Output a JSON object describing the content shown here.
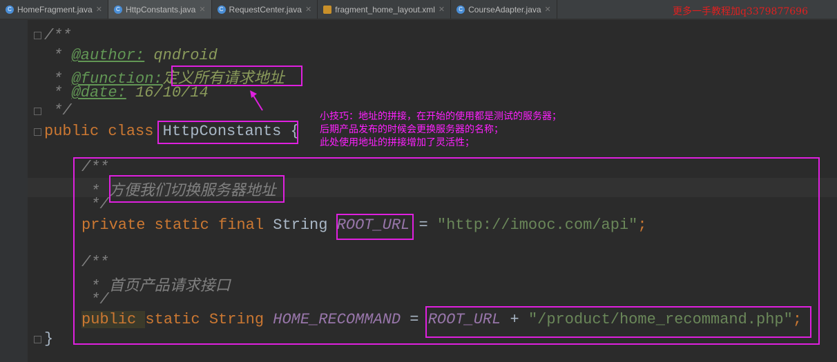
{
  "tabs": [
    {
      "label": "HomeFragment.java",
      "icon": "class-icon"
    },
    {
      "label": "HttpConstants.java",
      "icon": "class-icon",
      "active": true
    },
    {
      "label": "RequestCenter.java",
      "icon": "class-icon"
    },
    {
      "label": "fragment_home_layout.xml",
      "icon": "xml-icon"
    },
    {
      "label": "CourseAdapter.java",
      "icon": "class-icon"
    }
  ],
  "promo": "更多一手教程加q3379877696",
  "code": {
    "l1": "/**",
    "l2a": " * ",
    "l2tag": "@author:",
    "l2v": " qndroid",
    "l3a": " * ",
    "l3tag": "@function:",
    "l3v": "定义所有请求地址",
    "l4a": " * ",
    "l4tag": "@date:",
    "l4v": " 16/10/14",
    "l5": " */",
    "l6kw": "public class ",
    "l6n": "HttpConstants",
    "l6e": " {",
    "l7": "/**",
    "l8": " * 方便我们切换服务器地址",
    "l9": " */",
    "l10kw": "private static final ",
    "l10t": "String ",
    "l10c": "ROOT_URL",
    "l10e": " = ",
    "l10s": "\"http://imooc.com/api\"",
    "l10semi": ";",
    "l11": "/**",
    "l12": " * 首页产品请求接口",
    "l13": " */",
    "l14kw": "public ",
    "l14b": "static String ",
    "l14c": "HOME_RECOMMAND",
    "l14e": " = ",
    "l14c2": "ROOT_URL",
    "l14p": " + ",
    "l14s": "\"/product/home_recommand.php\"",
    "l14semi": ";",
    "l15": "}"
  },
  "note": [
    "小技巧：地址的拼接，在开始的使用都是测试的服务器；",
    "后期产品发布的时候会更换服务器的名称；",
    "此处使用地址的拼接增加了灵活性；"
  ]
}
